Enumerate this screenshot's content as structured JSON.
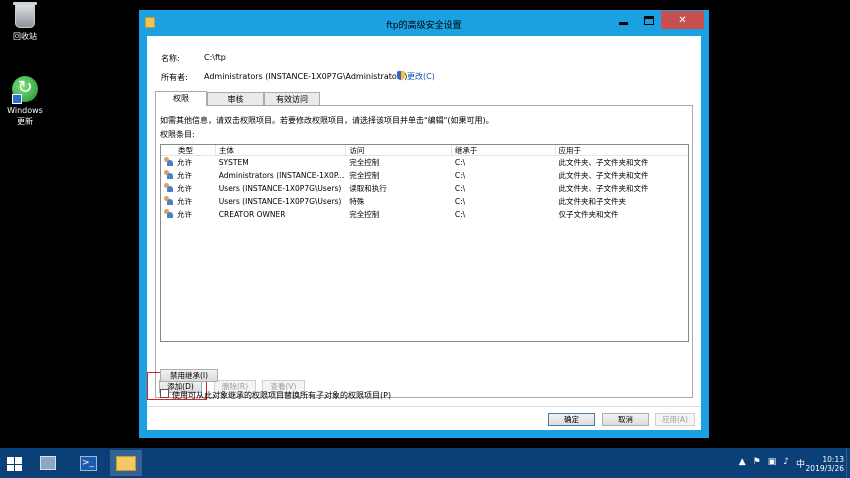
{
  "desktop": {
    "recycle_bin_label": "回收站",
    "windows_update_label": "Windows 更新"
  },
  "window": {
    "title": "ftp的高级安全设置",
    "name_label": "名称:",
    "name_value": "C:\\ftp",
    "owner_label": "所有者:",
    "owner_value": "Administrators (INSTANCE-1X0P7G\\Administrators)",
    "change_link": "更改(C)",
    "tabs": [
      {
        "label": "权限",
        "active": true
      },
      {
        "label": "审核",
        "active": false
      },
      {
        "label": "有效访问",
        "active": false
      }
    ],
    "info_text": "如需其他信息，请双击权限项目。若要修改权限项目，请选择该项目并单击\"编辑\"(如果可用)。",
    "entries_label": "权限条目:",
    "columns": [
      "类型",
      "主体",
      "访问",
      "继承于",
      "应用于"
    ],
    "rows": [
      {
        "type": "允许",
        "principal": "SYSTEM",
        "access": "完全控制",
        "inherited": "C:\\",
        "applies": "此文件夹、子文件夹和文件"
      },
      {
        "type": "允许",
        "principal": "Administrators (INSTANCE-1X0P...",
        "access": "完全控制",
        "inherited": "C:\\",
        "applies": "此文件夹、子文件夹和文件"
      },
      {
        "type": "允许",
        "principal": "Users (INSTANCE-1X0P7G\\Users)",
        "access": "读取和执行",
        "inherited": "C:\\",
        "applies": "此文件夹、子文件夹和文件"
      },
      {
        "type": "允许",
        "principal": "Users (INSTANCE-1X0P7G\\Users)",
        "access": "特殊",
        "inherited": "C:\\",
        "applies": "此文件夹和子文件夹"
      },
      {
        "type": "允许",
        "principal": "CREATOR OWNER",
        "access": "完全控制",
        "inherited": "C:\\",
        "applies": "仅子文件夹和文件"
      }
    ],
    "add_button": "添加(D)",
    "remove_button": "删除(R)",
    "view_button": "查看(V)",
    "disable_inheritance_button": "禁用继承(I)",
    "replace_checkbox_label": "使用可从此对象继承的权限项目替换所有子对象的权限项目(P)",
    "ok_button": "确定",
    "cancel_button": "取消",
    "apply_button": "应用(A)"
  },
  "taskbar": {
    "ime_label": "中",
    "time": "10:13",
    "date": "2019/3/26"
  },
  "colors": {
    "window_frame": "#1ba1e2",
    "taskbar": "#0b3f78",
    "highlight_box": "#e02020"
  }
}
